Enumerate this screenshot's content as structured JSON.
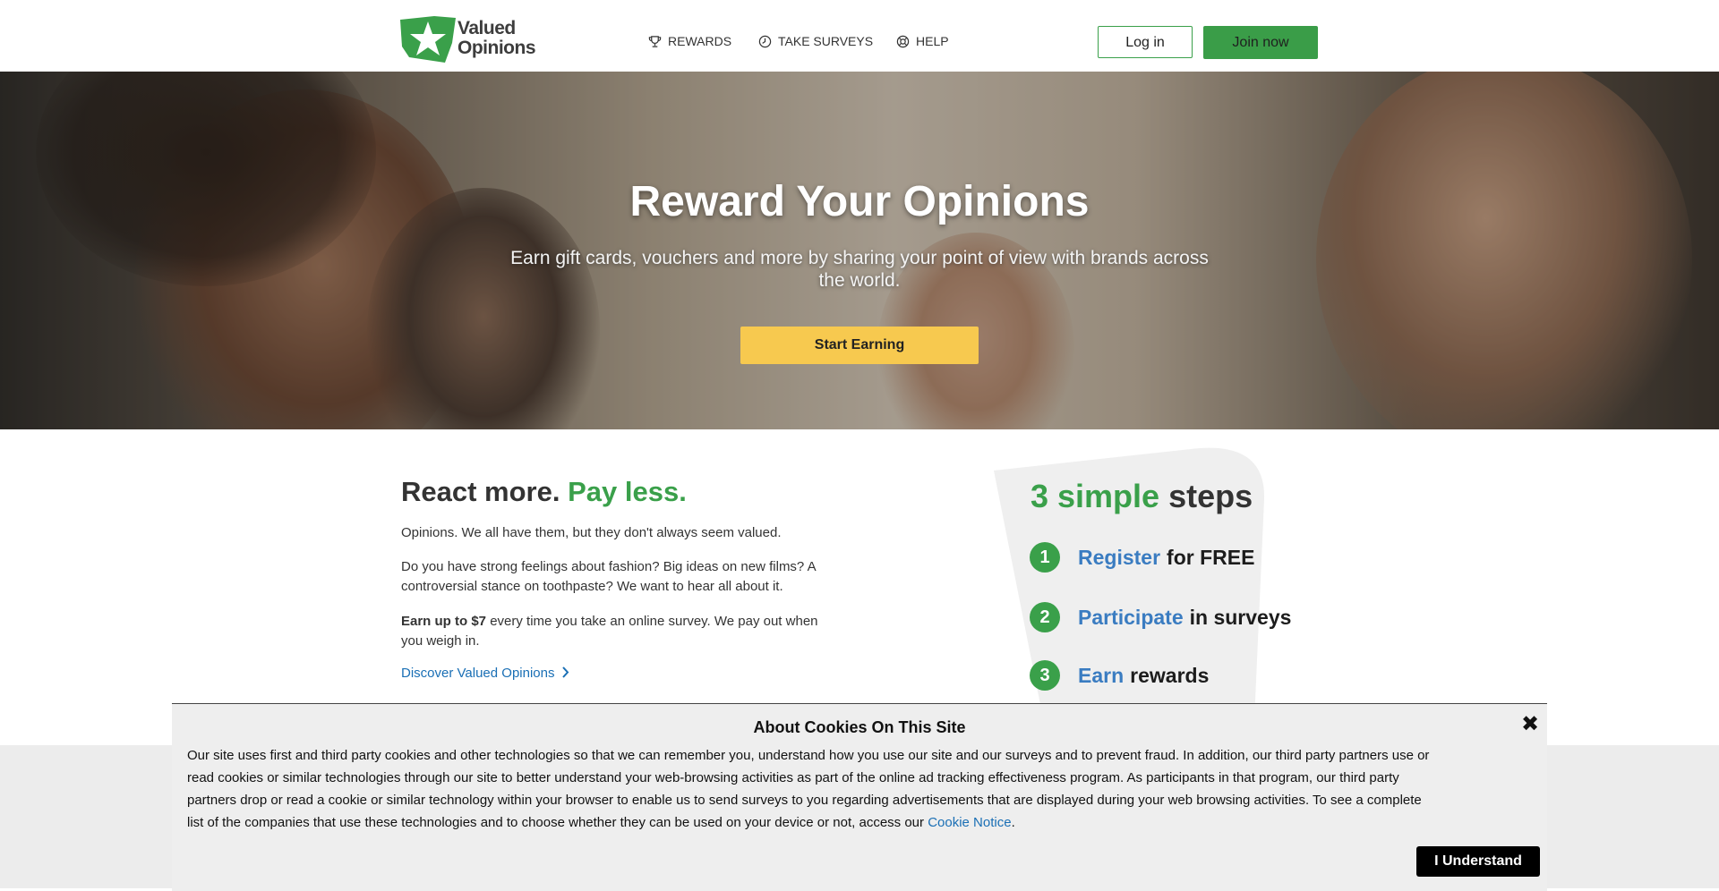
{
  "brand": {
    "name_line1": "Valued",
    "name_line2": "Opinions",
    "accent": "#3aa04a",
    "cta_yellow": "#f7c94f",
    "link_blue": "#1a6fb5"
  },
  "nav": {
    "rewards": {
      "label": "REWARDS",
      "icon": "trophy-icon"
    },
    "surveys": {
      "label": "TAKE SURVEYS",
      "icon": "clock-icon"
    },
    "help": {
      "label": "HELP",
      "icon": "lifebuoy-icon"
    }
  },
  "header": {
    "login_label": "Log in",
    "join_label": "Join now"
  },
  "hero": {
    "title": "Reward Your Opinions",
    "subtitle": "Earn gift cards, vouchers and more by sharing your point of view with brands across the world.",
    "cta_label": "Start Earning"
  },
  "intro": {
    "title_dark": "React more.",
    "title_green": "Pay less.",
    "para1": "Opinions. We all have them, but they don't always seem valued.",
    "para2": "Do you have strong feelings about fashion? Big ideas on new films? A controversial stance on toothpaste? We want to hear all about it.",
    "para3_bold": "Earn up to $7",
    "para3_rest": " every time you take an online survey. We pay out when you weigh in.",
    "discover_label": "Discover Valued Opinions"
  },
  "steps": {
    "title_green": "3 simple",
    "title_dark": "steps",
    "items": [
      {
        "num": "1",
        "highlight": "Register",
        "rest": "for FREE"
      },
      {
        "num": "2",
        "highlight": "Participate",
        "rest": "in surveys"
      },
      {
        "num": "3",
        "highlight": "Earn",
        "rest": "rewards"
      }
    ]
  },
  "cookie": {
    "title": "About Cookies On This Site",
    "close_icon": "close-icon",
    "text": "Our site uses first and third party cookies and other technologies so that we can remember you, understand how you use our site and our surveys and to prevent fraud. In addition, our third party partners use or read cookies or similar technologies through our site to better understand your web-browsing activities as part of the online ad tracking effectiveness program. As participants in that program, our third party partners drop or read a cookie or similar technology within your browser to enable us to send surveys to you regarding advertisements that are displayed during your web browsing activities. To see a complete list of the companies that use these technologies and to choose whether they can be used on your device or not, access our ",
    "link_label": "Cookie Notice",
    "text_end": ".",
    "button_label": "I Understand"
  }
}
